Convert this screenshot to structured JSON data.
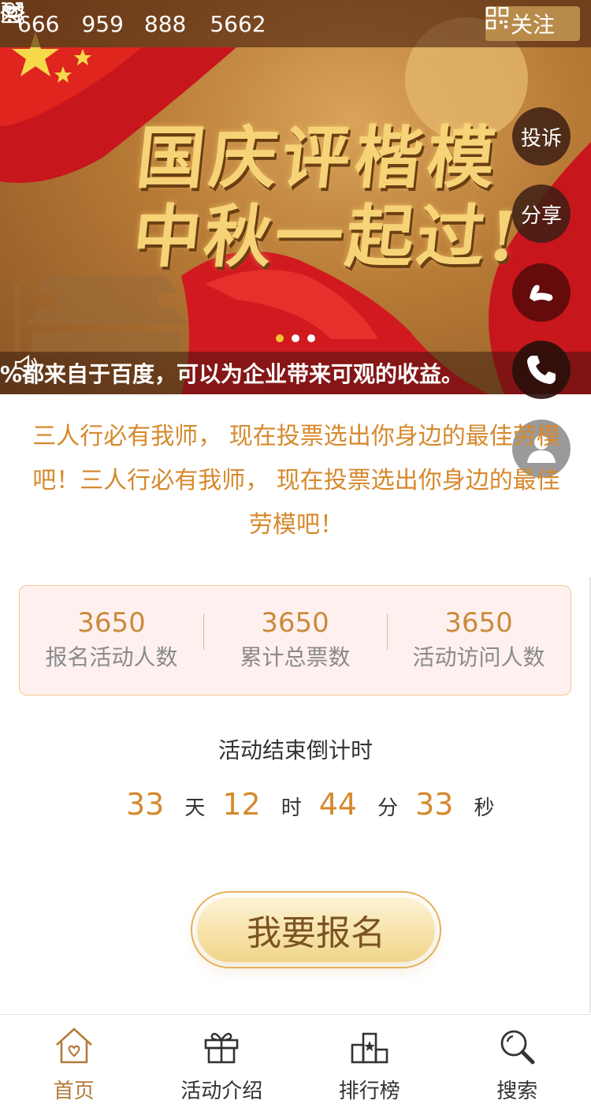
{
  "stats_bar": {
    "views": "666",
    "shares": "959",
    "participants": "888",
    "cart": "5662",
    "follow_label": "关注"
  },
  "banner": {
    "title_line1": "国庆评楷模",
    "title_line2": "中秋一起过!",
    "notice_text": "%都来自于百度，可以为企业带来可观的收益。",
    "slides": 3,
    "active_slide": 1
  },
  "float_buttons": {
    "complaint": "投诉",
    "share": "分享"
  },
  "description": "三人行必有我师， 现在投票选出你身边的最佳劳模吧！三人行必有我师， 现在投票选出你身边的最佳劳模吧！",
  "stats": [
    {
      "value": "3650",
      "label": "报名活动人数"
    },
    {
      "value": "3650",
      "label": "累计总票数"
    },
    {
      "value": "3650",
      "label": "活动访问人数"
    }
  ],
  "countdown": {
    "title": "活动结束倒计时",
    "days": "33",
    "days_unit": "天",
    "hours": "12",
    "hours_unit": "时",
    "minutes": "44",
    "minutes_unit": "分",
    "seconds": "33",
    "seconds_unit": "秒"
  },
  "signup_label": "我要报名",
  "nav": [
    {
      "label": "首页",
      "icon": "home-icon"
    },
    {
      "label": "活动介绍",
      "icon": "gift-icon"
    },
    {
      "label": "排行榜",
      "icon": "ranking-icon"
    },
    {
      "label": "搜索",
      "icon": "search-icon"
    }
  ],
  "colors": {
    "accent": "#d6892d",
    "brand_gold": "#b98b4b",
    "stats_bg": "#fff0f0"
  }
}
